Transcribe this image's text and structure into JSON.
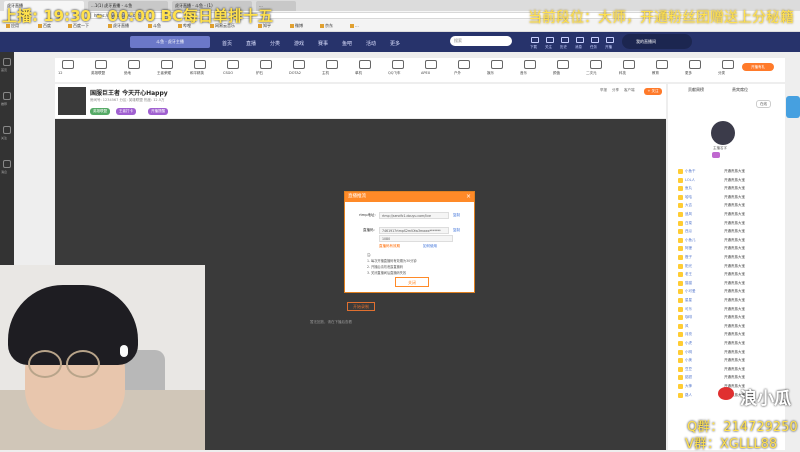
{
  "browser": {
    "tabs": [
      "虎牙直播",
      "...1(1) 虎牙直播 - 斗鱼",
      "虎牙直播 - 斗鱼 - (1)",
      "..."
    ],
    "url": "https://www.douyu.com/..."
  },
  "bookmarks": [
    "应用",
    "百度",
    "百度一下",
    "虎牙直播",
    "斗鱼",
    "哔哩",
    "网易云音乐",
    "知乎",
    "微博",
    "京东",
    "..."
  ],
  "overlay": {
    "left_text": "上播: 19:30 - 00:00 BC每日单排十五",
    "right_text": "当前段位：大师，开通粉丝团赠送上分秘籍"
  },
  "header": {
    "logo": "斗鱼 · 虎牙主播",
    "nav": [
      "首页",
      "直播",
      "分类",
      "游戏",
      "赛事",
      "鱼吧",
      "活动",
      "更多"
    ],
    "search_placeholder": "搜索",
    "icons": [
      "下载",
      "关注",
      "历史",
      "消息",
      "任务",
      "开播"
    ],
    "user_label": "我的直播间"
  },
  "left_rail": [
    "首页",
    "推荐",
    "关注",
    "消息"
  ],
  "categories": [
    "12",
    "英雄联盟",
    "绝地",
    "王者荣耀",
    "和平精英",
    "CSGO",
    "炉石",
    "DOTA2",
    "主机",
    "单机",
    "QQ飞车",
    "APEX",
    "户外",
    "娱乐",
    "音乐",
    "颜值",
    "二次元",
    "科技",
    "教育",
    "更多",
    "分类"
  ],
  "category_badge": "开播有礼",
  "room": {
    "title": "国服巨王者 今天开心Happy",
    "meta": "房间号: 1234567  分区: 英雄联盟  热度: 12.5万",
    "tags": [
      "英雄联盟",
      "王者打卡",
      "开播提醒"
    ],
    "right_info": [
      "举报",
      "分享",
      "客户端"
    ],
    "follow": "+ 关注"
  },
  "modal": {
    "title": "直播推流",
    "close": "×",
    "rtmp_label": "rtmp地址:",
    "rtmp_value": "rtmp://sendfc1.douyu.com/live",
    "rtmp_action": "复制",
    "key_label": "直播码:",
    "key_value": "7461917rtmpS2mVXw3mawx*******",
    "key_action": "复制",
    "select_value": "1080",
    "warn": "直播码有效期",
    "warn_link": "如何使用",
    "notes_label": "注:",
    "notes": [
      "1. 每次开播直播码有效期为30分钟",
      "2. 开播后请勿泄露直播码",
      "3. 关闭直播间后直播码失效"
    ],
    "confirm": "关闭"
  },
  "player": {
    "record_btn": "开始录制",
    "tip": "暂无回放，请在下播后查看"
  },
  "side_panel": {
    "tabs": [
      "贡献周榜",
      "贵宾席位"
    ],
    "pills": [
      "在线"
    ],
    "streamer_name": "主播名字",
    "rank_rows": [
      {
        "name": "小鱼干",
        "tail": "开通贵族大宝"
      },
      {
        "name": "LOL人",
        "tail": "开通贵族大宝"
      },
      {
        "name": "鱼丸",
        "tail": "开通贵族大宝"
      },
      {
        "name": "哈哈",
        "tail": "开通贵族大宝"
      },
      {
        "name": "大吉",
        "tail": "开通贵族大宝"
      },
      {
        "name": "追风",
        "tail": "开通贵族大宝"
      },
      {
        "name": "白菜",
        "tail": "开通贵族大宝"
      },
      {
        "name": "西瓜",
        "tail": "开通贵族大宝"
      },
      {
        "name": "小鱼儿",
        "tail": "开通贵族大宝"
      },
      {
        "name": "阿狸",
        "tail": "开通贵族大宝"
      },
      {
        "name": "橙子",
        "tail": "开通贵族大宝"
      },
      {
        "name": "阳光",
        "tail": "开通贵族大宝"
      },
      {
        "name": "老王",
        "tail": "开通贵族大宝"
      },
      {
        "name": "猫猫",
        "tail": "开通贵族大宝"
      },
      {
        "name": "小可爱",
        "tail": "开通贵族大宝"
      },
      {
        "name": "星星",
        "tail": "开通贵族大宝"
      },
      {
        "name": "可乐",
        "tail": "开通贵族大宝"
      },
      {
        "name": "咖啡",
        "tail": "开通贵族大宝"
      },
      {
        "name": "风",
        "tail": "开通贵族大宝"
      },
      {
        "name": "月亮",
        "tail": "开通贵族大宝"
      },
      {
        "name": "小虎",
        "tail": "开通贵族大宝"
      },
      {
        "name": "小明",
        "tail": "开通贵族大宝"
      },
      {
        "name": "小美",
        "tail": "开通贵族大宝"
      },
      {
        "name": "豆豆",
        "tail": "开通贵族大宝"
      },
      {
        "name": "甜甜",
        "tail": "开通贵族大宝"
      },
      {
        "name": "大神",
        "tail": "开通贵族大宝"
      },
      {
        "name": "路人",
        "tail": "开通贵族大宝"
      }
    ]
  },
  "stream_overlay": {
    "weibo": "浪小瓜",
    "qq": "Q群：214729250",
    "wx": "V群：XGLLL88"
  },
  "colors": {
    "header": "#27336b",
    "accent": "#ff8a28",
    "overlay_text": "#ffe14d"
  }
}
